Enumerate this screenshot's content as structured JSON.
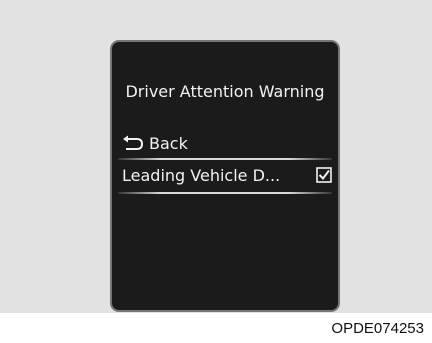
{
  "screen": {
    "title": "Driver Attention Warning",
    "back": {
      "icon": "back-arrow-icon",
      "label": "Back"
    },
    "menu_items": [
      {
        "label": "Leading Vehicle D...",
        "checked": true,
        "icon": "checkbox-checked-icon"
      }
    ]
  },
  "figure_code": "OPDE074253",
  "colors": {
    "panel_background": "#e2e2e2",
    "screen_background": "#1b1b1b",
    "screen_border": "#777777",
    "text": "#f2f2f2"
  }
}
